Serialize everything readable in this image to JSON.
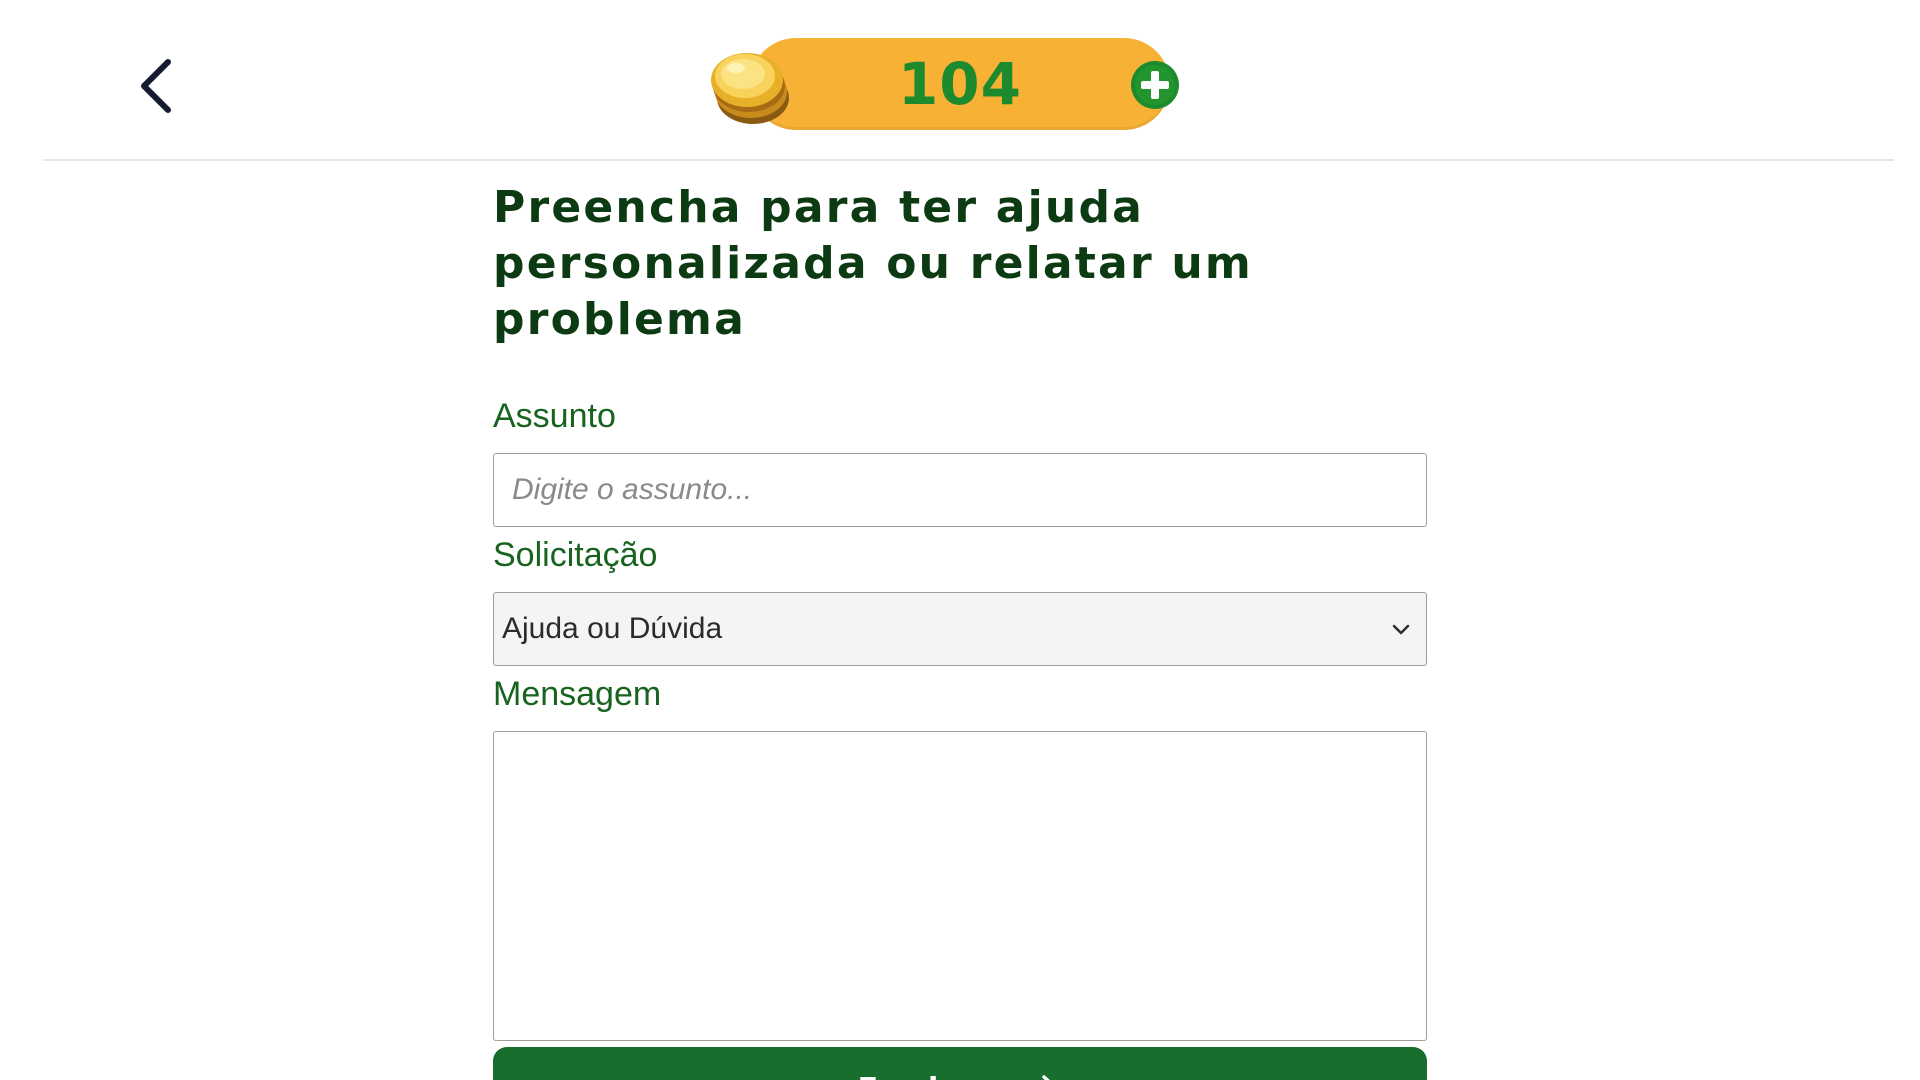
{
  "header": {
    "back_icon": "chevron-left-icon",
    "coins": {
      "count": "104",
      "icon": "coin-stack-icon",
      "add_icon": "plus-circle-icon"
    }
  },
  "form": {
    "title_line1": "Preencha para ter ajuda",
    "title_line2": "personalizada ou relatar um problema",
    "subject": {
      "label": "Assunto",
      "placeholder": "Digite o assunto...",
      "value": ""
    },
    "request": {
      "label": "Solicitação",
      "selected": "Ajuda ou Dúvida"
    },
    "message": {
      "label": "Mensagem",
      "value": ""
    },
    "submit": {
      "label": "Enviar",
      "icon": "arrow-right-icon"
    }
  },
  "colors": {
    "accent_green": "#176e2d",
    "label_green": "#17631f",
    "title_green": "#0c3a12",
    "coin_pill": "#f7b135",
    "coin_text": "#1e8a2e"
  }
}
